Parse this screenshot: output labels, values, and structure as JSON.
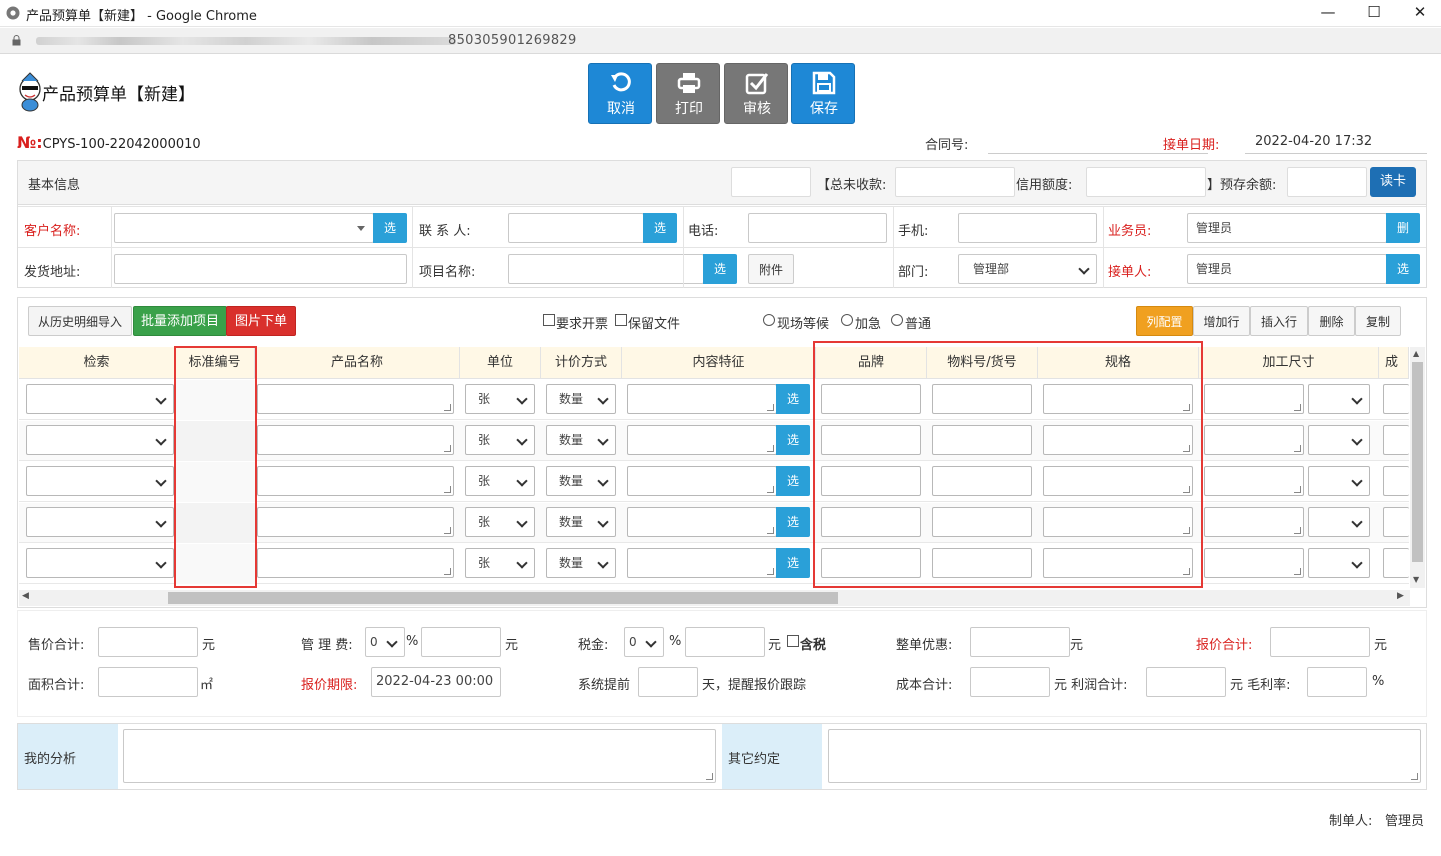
{
  "window": {
    "title": "产品预算单【新建】 - Google Chrome",
    "url_tail": "850305901269829"
  },
  "header": {
    "title": "产品预算单【新建】"
  },
  "toolbar": {
    "cancel": "取消",
    "print": "打印",
    "audit": "审核",
    "save": "保存"
  },
  "order": {
    "no_label": "№:",
    "no_value": "CPYS-100-22042000010",
    "contract_label": "合同号:",
    "date_label": "接单日期:",
    "date_value": "2022-04-20 17:32"
  },
  "basic": {
    "title": "基本信息",
    "unpaid_label": "【总未收款:",
    "credit_label": "信用额度:",
    "balance_label": "】预存余额:",
    "readcard": "读卡",
    "customer_label": "客户名称:",
    "contact_label": "联 系 人:",
    "phone_label": "电话:",
    "mobile_label": "手机:",
    "sales_label": "业务员:",
    "sales_value": "管理员",
    "address_label": "发货地址:",
    "project_label": "项目名称:",
    "attach": "附件",
    "dept_label": "部门:",
    "dept_value": "管理部",
    "receiver_label": "接单人:",
    "receiver_value": "管理员",
    "select": "选",
    "delete": "删"
  },
  "items": {
    "btn_history": "从历史明细导入",
    "btn_batch": "批量添加项目",
    "btn_image": "图片下单",
    "chk_invoice": "要求开票",
    "chk_keep": "保留文件",
    "rad_onsite": "现场等候",
    "rad_urgent": "加急",
    "rad_normal": "普通",
    "btn_cols": "列配置",
    "btn_addrow": "增加行",
    "btn_insert": "插入行",
    "btn_delete": "删除",
    "btn_copy": "复制",
    "columns": [
      "检索",
      "标准编号",
      "产品名称",
      "单位",
      "计价方式",
      "内容特征",
      "品牌",
      "物料号/货号",
      "规格",
      "加工尺寸",
      "成本"
    ],
    "unit_value": "张",
    "pricing_value": "数量",
    "select": "选",
    "row_count": 5
  },
  "totals": {
    "sale_label": "售价合计:",
    "yuan": "元",
    "mgmt_label": "管 理 费:",
    "mgmt_value": "0",
    "pct": "%",
    "tax_label": "税金:",
    "tax_value": "0",
    "tax_incl": "含税",
    "discount_label": "整单优惠:",
    "quote_label": "报价合计:",
    "area_label": "面积合计:",
    "sqm": "㎡",
    "deadline_label": "报价期限:",
    "deadline_value": "2022-04-23 00:00",
    "remind_pre": "系统提前",
    "remind_post": "天，提醒报价跟踪",
    "cost_label": "成本合计:",
    "profit_label": "元 利润合计:",
    "margin_label": "元 毛利率:"
  },
  "notes": {
    "analysis": "我的分析",
    "other": "其它约定"
  },
  "footer": {
    "maker_label": "制单人:",
    "maker_value": "管理员"
  }
}
